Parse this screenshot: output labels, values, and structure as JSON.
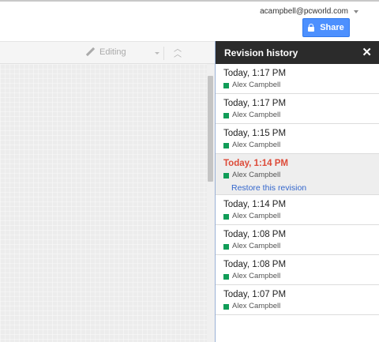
{
  "account": {
    "email": "acampbell@pcworld.com"
  },
  "share": {
    "label": "Share"
  },
  "toolbar": {
    "mode_label": "Editing"
  },
  "panel": {
    "title": "Revision history",
    "close_label": "✕",
    "restore_label": "Restore this revision",
    "revisions": [
      {
        "time": "Today, 1:17 PM",
        "author": "Alex Campbell"
      },
      {
        "time": "Today, 1:17 PM",
        "author": "Alex Campbell"
      },
      {
        "time": "Today, 1:15 PM",
        "author": "Alex Campbell"
      },
      {
        "time": "Today, 1:14 PM",
        "author": "Alex Campbell",
        "selected": true
      },
      {
        "time": "Today, 1:14 PM",
        "author": "Alex Campbell"
      },
      {
        "time": "Today, 1:08 PM",
        "author": "Alex Campbell"
      },
      {
        "time": "Today, 1:08 PM",
        "author": "Alex Campbell"
      },
      {
        "time": "Today, 1:07 PM",
        "author": "Alex Campbell"
      }
    ]
  },
  "colors": {
    "author_swatch": "#109d58",
    "selected_time": "#dd4b39",
    "share_button": "#4d90fe",
    "link": "#3366cc"
  },
  "icons": {
    "share": "lock-icon",
    "toolbar_mode": "pencil-icon",
    "collapse": "double-chevron-up-icon",
    "close": "close-icon"
  }
}
